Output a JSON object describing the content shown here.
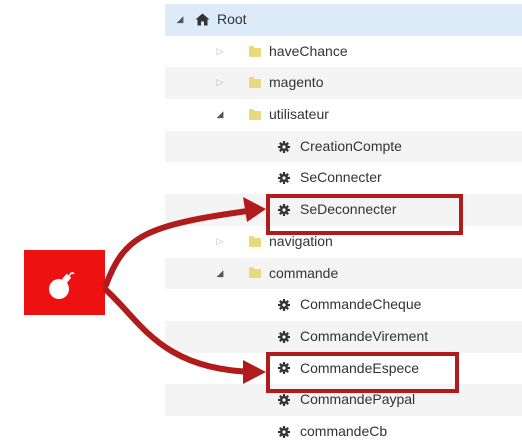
{
  "tree": {
    "root": {
      "label": "Root",
      "icon": "home-icon"
    },
    "items": [
      {
        "label": "haveChance",
        "type": "folder",
        "state": "collapsed"
      },
      {
        "label": "magento",
        "type": "folder",
        "state": "collapsed"
      },
      {
        "label": "utilisateur",
        "type": "folder",
        "state": "expanded"
      },
      {
        "label": "CreationCompte",
        "type": "scenario"
      },
      {
        "label": "SeConnecter",
        "type": "scenario"
      },
      {
        "label": "SeDeconnecter",
        "type": "scenario",
        "highlighted": true
      },
      {
        "label": "navigation",
        "type": "folder",
        "state": "collapsed"
      },
      {
        "label": "commande",
        "type": "folder",
        "state": "expanded"
      },
      {
        "label": "CommandeCheque",
        "type": "scenario"
      },
      {
        "label": "CommandeVirement",
        "type": "scenario"
      },
      {
        "label": "CommandeEspece",
        "type": "scenario",
        "highlighted": true
      },
      {
        "label": "CommandePaypal",
        "type": "scenario"
      },
      {
        "label": "commandeCb",
        "type": "scenario"
      }
    ]
  },
  "annotation": {
    "icon": "bomb-icon",
    "tile_color": "#ee1111",
    "arrow_color": "#b01c1c"
  },
  "colors": {
    "highlight_border": "#b01c1c",
    "root_row": "#dcebf7",
    "folder": "#e8d97a"
  }
}
